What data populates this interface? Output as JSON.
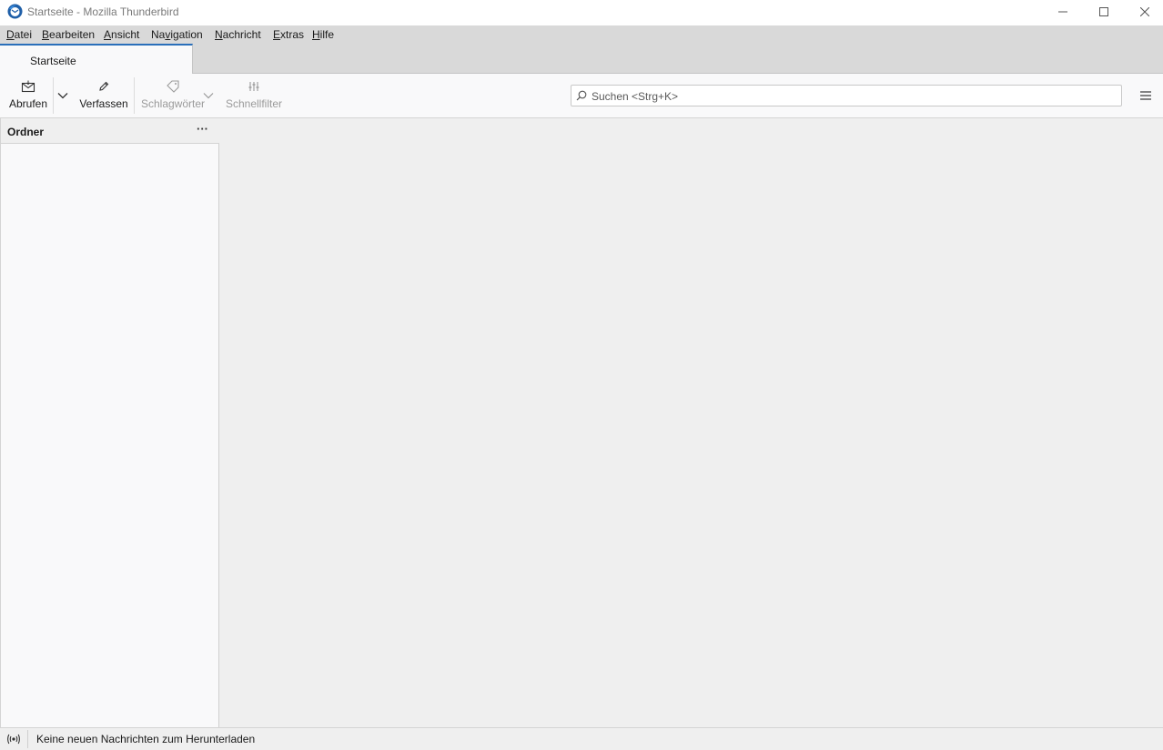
{
  "window": {
    "title": "Startseite - Mozilla Thunderbird"
  },
  "menubar": {
    "items": [
      {
        "accel": "D",
        "rest": "atei"
      },
      {
        "accel": "B",
        "rest": "earbeiten"
      },
      {
        "accel": "A",
        "rest": "nsicht"
      },
      {
        "pre": "Na",
        "accel": "v",
        "rest": "igation"
      },
      {
        "accel": "N",
        "rest": "achricht"
      },
      {
        "accel": "E",
        "rest": "xtras"
      },
      {
        "accel": "H",
        "rest": "ilfe"
      }
    ]
  },
  "tabs": [
    {
      "label": "Startseite",
      "selected": true
    }
  ],
  "toolbar": {
    "get_messages_label": "Abrufen",
    "compose_label": "Verfassen",
    "tags_label": "Schlagwörter",
    "quick_filter_label": "Schnellfilter",
    "search_placeholder": "Suchen <Strg+K>"
  },
  "folder_pane": {
    "title": "Ordner",
    "more_label": "···"
  },
  "statusbar": {
    "text": "Keine neuen Nachrichten zum Herunterladen"
  },
  "colors": {
    "accent": "#2a6fba",
    "menubar_bg": "#d9d9d9",
    "content_bg": "#efefef",
    "pane_bg": "#f9f9fa"
  },
  "icons": {
    "app": "thunderbird-logo-icon",
    "get_messages": "envelope-download-icon",
    "compose": "pencil-icon",
    "tags": "tag-icon",
    "quick_filter": "sliders-icon",
    "search": "search-icon",
    "menu": "hamburger-icon",
    "status": "broadcast-icon"
  }
}
